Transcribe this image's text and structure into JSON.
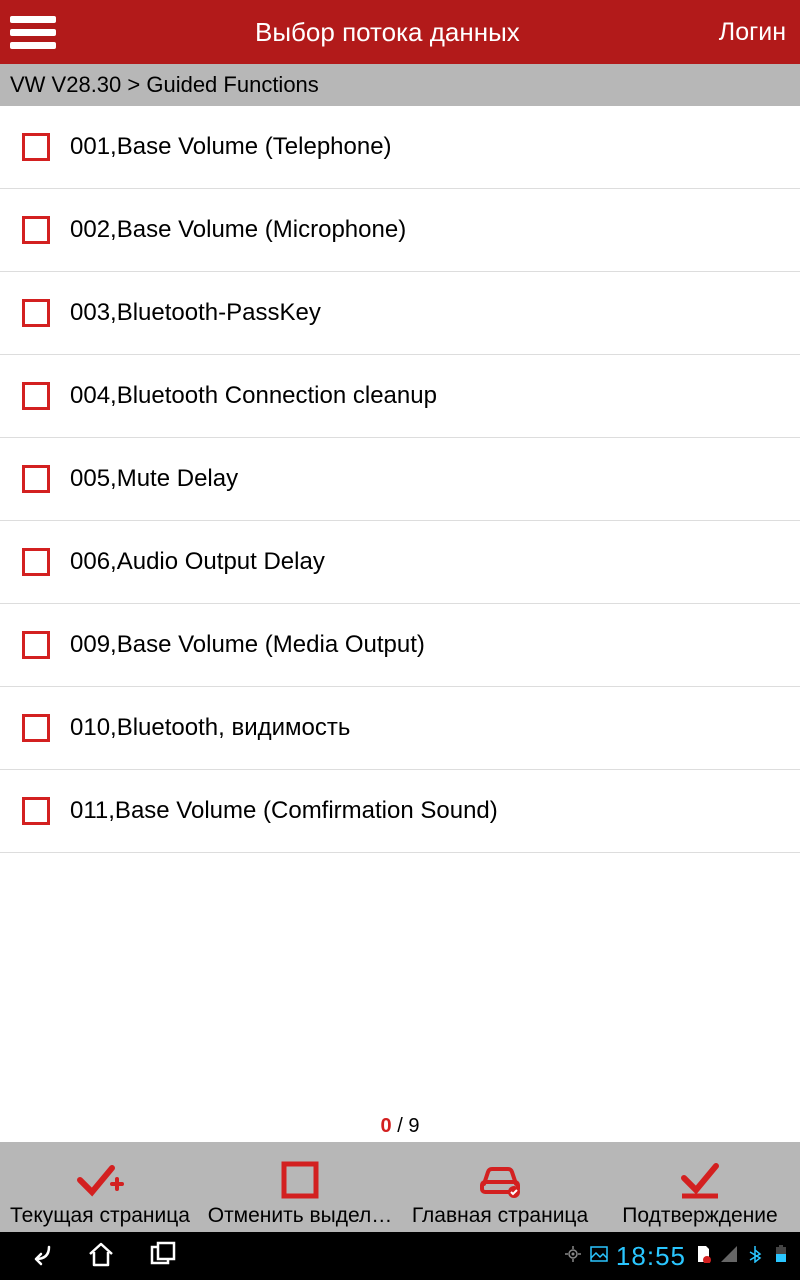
{
  "header": {
    "title": "Выбор потока данных",
    "login": "Логин"
  },
  "breadcrumb": "VW V28.30 > Guided Functions",
  "items": [
    {
      "label": "001,Base Volume (Telephone)"
    },
    {
      "label": "002,Base Volume (Microphone)"
    },
    {
      "label": "003,Bluetooth-PassKey"
    },
    {
      "label": "004,Bluetooth Connection cleanup"
    },
    {
      "label": "005,Mute Delay"
    },
    {
      "label": "006,Audio Output Delay"
    },
    {
      "label": "009,Base Volume (Media Output)"
    },
    {
      "label": "010,Bluetooth, видимость"
    },
    {
      "label": "011,Base Volume (Comfirmation Sound)"
    }
  ],
  "pager": {
    "current": "0",
    "sep": " / ",
    "total": "9"
  },
  "toolbar": {
    "current_page": "Текущая страница",
    "deselect": "Отменить выдел…",
    "home": "Главная страница",
    "confirm": "Подтверждение"
  },
  "status": {
    "time": "18:55"
  }
}
